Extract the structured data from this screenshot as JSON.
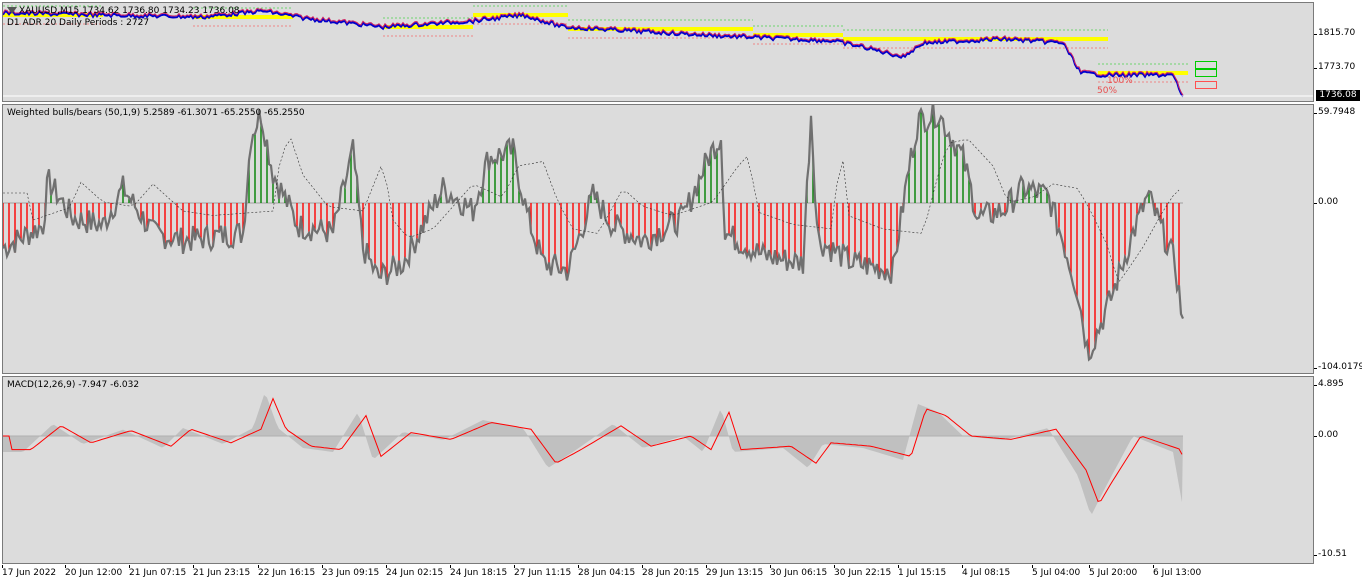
{
  "price_pane": {
    "header": "XAUUSD,M15  1734.62 1736.80 1734.23 1736.08",
    "sub_header": "D1 ADR 20 Daily Periods : 2727",
    "axis_ticks": [
      "1815.70",
      "1773.70"
    ],
    "current_price": "1736.08",
    "fib_labels": [
      "100%",
      "50%"
    ]
  },
  "bb_pane": {
    "label": "Weighted bulls/bears (50,1,9) 5.2589 -61.3071 -65.2550 -65.2550",
    "axis_ticks": [
      "59.7948",
      "0.00",
      "-104.0179"
    ]
  },
  "macd_pane": {
    "label": "MACD(12,26,9) -7.947 -6.032",
    "axis_ticks": [
      "4.895",
      "0.00",
      "-10.51"
    ]
  },
  "time_axis": [
    "17 Jun 2022",
    "20 Jun 12:00",
    "21 Jun 07:15",
    "21 Jun 23:15",
    "22 Jun 16:15",
    "23 Jun 09:15",
    "24 Jun 02:15",
    "24 Jun 18:15",
    "27 Jun 11:15",
    "28 Jun 04:15",
    "28 Jun 20:15",
    "29 Jun 13:15",
    "30 Jun 06:15",
    "30 Jun 22:15",
    "1 Jul 15:15",
    "4 Jul 08:15",
    "5 Jul 04:00",
    "5 Jul 20:00",
    "6 Jul 13:00"
  ],
  "colors": {
    "bull": "#008000",
    "bear": "#ff0000",
    "price_line": "#0000cc",
    "signal_line": "#ff0000",
    "level_band": "#ffff00",
    "histogram_gray": "#c0c0c0"
  }
}
